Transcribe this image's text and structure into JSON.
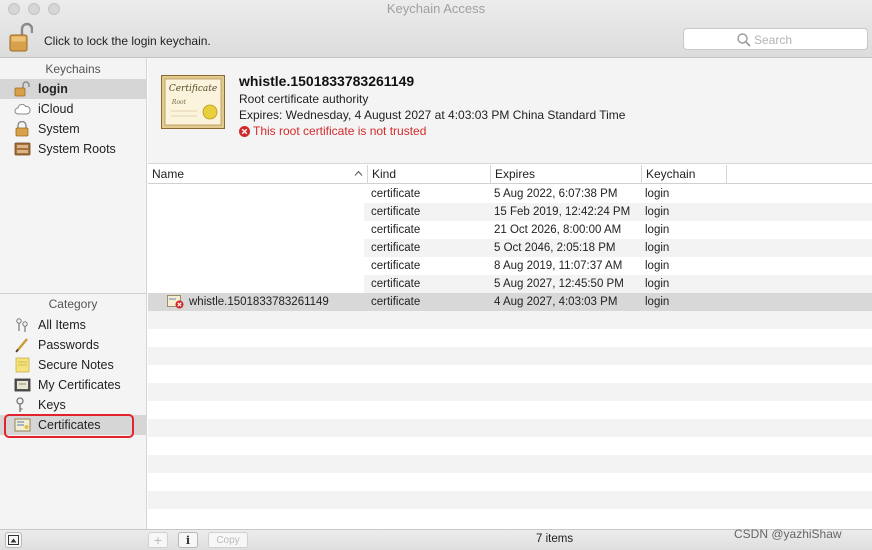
{
  "window": {
    "title": "Keychain Access"
  },
  "toolbar": {
    "lock_text": "Click to lock the login keychain.",
    "search_placeholder": "Search"
  },
  "sidebar": {
    "keychains_header": "Keychains",
    "keychains": [
      {
        "label": "login",
        "icon": "open-lock-icon",
        "selected": true
      },
      {
        "label": "iCloud",
        "icon": "cloud-icon"
      },
      {
        "label": "System",
        "icon": "lock-icon"
      },
      {
        "label": "System Roots",
        "icon": "cabinet-icon"
      }
    ],
    "category_header": "Category",
    "categories": [
      {
        "label": "All Items",
        "icon": "all-items-icon"
      },
      {
        "label": "Passwords",
        "icon": "pen-icon"
      },
      {
        "label": "Secure Notes",
        "icon": "note-icon"
      },
      {
        "label": "My Certificates",
        "icon": "my-certificate-icon"
      },
      {
        "label": "Keys",
        "icon": "key-icon"
      },
      {
        "label": "Certificates",
        "icon": "certificate-icon",
        "selected": true
      }
    ]
  },
  "info": {
    "name": "whistle.1501833783261149",
    "type": "Root certificate authority",
    "expires": "Expires: Wednesday, 4 August 2027 at 4:03:03 PM China Standard Time",
    "warning": "This root certificate is not trusted",
    "certificate_image_text": {
      "line1": "Certificate",
      "line2": "Root"
    }
  },
  "table": {
    "columns": [
      "Name",
      "Kind",
      "Expires",
      "Keychain"
    ],
    "rows": [
      {
        "name": "",
        "kind": "certificate",
        "expires": "5 Aug 2022, 6:07:38 PM",
        "keychain": "login"
      },
      {
        "name": "",
        "kind": "certificate",
        "expires": "15 Feb 2019, 12:42:24 PM",
        "keychain": "login"
      },
      {
        "name": "",
        "kind": "certificate",
        "expires": "21 Oct 2026, 8:00:00 AM",
        "keychain": "login"
      },
      {
        "name": "",
        "kind": "certificate",
        "expires": "5 Oct 2046, 2:05:18 PM",
        "keychain": "login"
      },
      {
        "name": "",
        "kind": "certificate",
        "expires": "8 Aug 2019, 11:07:37 AM",
        "keychain": "login"
      },
      {
        "name": "",
        "kind": "certificate",
        "expires": "5 Aug 2027, 12:45:50 PM",
        "keychain": "login"
      },
      {
        "name": "whistle.1501833783261149",
        "kind": "certificate",
        "expires": "4 Aug 2027, 4:03:03 PM",
        "keychain": "login",
        "selected": true
      }
    ]
  },
  "bottombar": {
    "add_label": "+",
    "info_label": "i",
    "copy_label": "Copy",
    "count": "7 items"
  },
  "watermark": "CSDN @yazhiShaw",
  "colors": {
    "warning": "#d12a2a",
    "selection": "#d6d6d6",
    "highlight_box": "#e3232c"
  }
}
